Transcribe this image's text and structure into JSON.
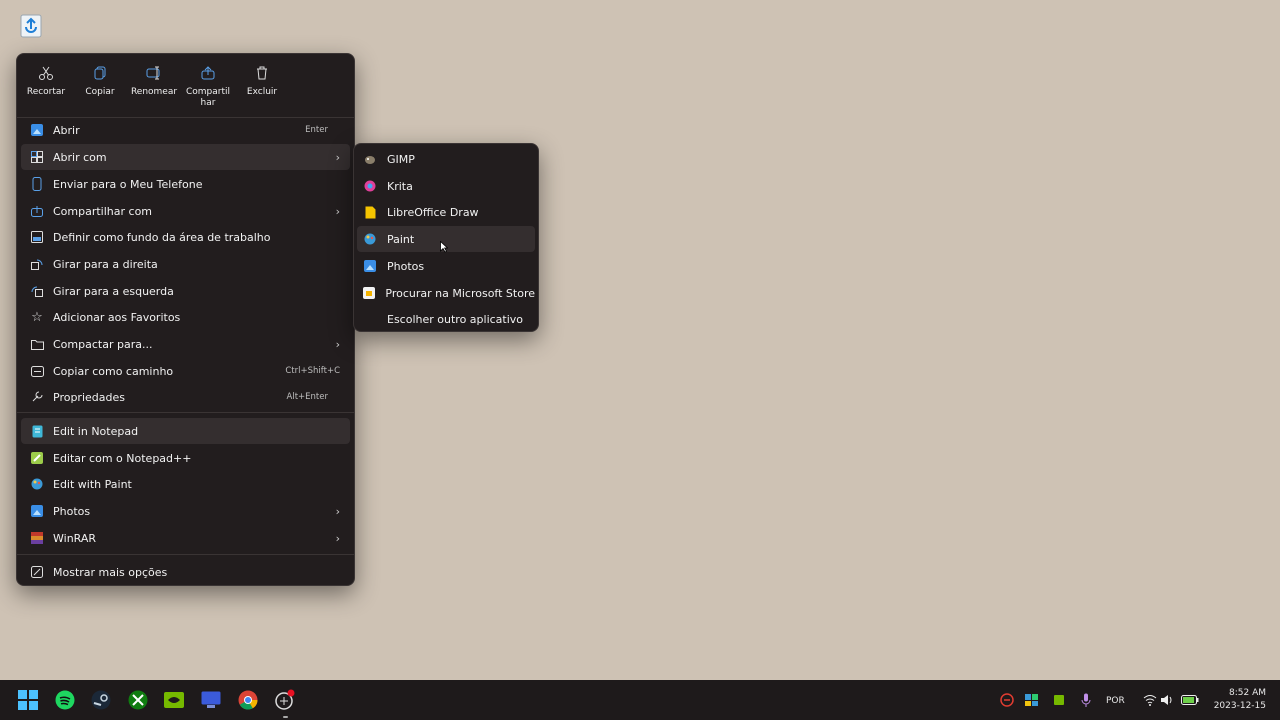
{
  "toolbar": {
    "cut": "Recortar",
    "copy": "Copiar",
    "rename": "Renomear",
    "share": "Compartil\nhar",
    "delete": "Excluir"
  },
  "menu": {
    "open": {
      "label": "Abrir",
      "shortcut": "Enter"
    },
    "open_with": {
      "label": "Abrir com"
    },
    "send_phone": {
      "label": "Enviar para o Meu Telefone"
    },
    "share_with": {
      "label": "Compartilhar com"
    },
    "set_wallpaper": {
      "label": "Definir como fundo da área de trabalho"
    },
    "rotate_right": {
      "label": "Girar para a direita"
    },
    "rotate_left": {
      "label": "Girar para a esquerda"
    },
    "add_favorites": {
      "label": "Adicionar aos Favoritos"
    },
    "compress": {
      "label": "Compactar para..."
    },
    "copy_path": {
      "label": "Copiar como caminho",
      "shortcut": "Ctrl+Shift+C"
    },
    "properties": {
      "label": "Propriedades",
      "shortcut": "Alt+Enter"
    },
    "edit_notepad": {
      "label": "Edit in Notepad"
    },
    "edit_notepadpp": {
      "label": "Editar com o Notepad++"
    },
    "edit_paint": {
      "label": "Edit with Paint"
    },
    "photos": {
      "label": "Photos"
    },
    "winrar": {
      "label": "WinRAR"
    },
    "more_options": {
      "label": "Mostrar mais opções"
    }
  },
  "submenu": {
    "gimp": "GIMP",
    "krita": "Krita",
    "libreoffice_draw": "LibreOffice Draw",
    "paint": "Paint",
    "photos": "Photos",
    "store": "Procurar na Microsoft Store",
    "other": "Escolher outro aplicativo"
  },
  "tray": {
    "language": "POR",
    "time": "8:52 AM",
    "date": "2023-12-15"
  },
  "colors": {
    "desktop": "#cec2b4",
    "menu_bg": "#221d1e",
    "highlight": "#342e2f",
    "taskbar": "#1e1a1b"
  }
}
